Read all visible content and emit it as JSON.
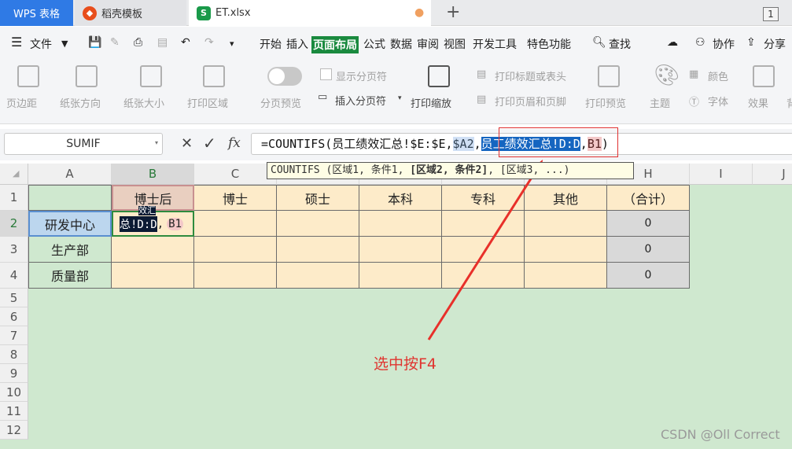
{
  "tabs": {
    "wps": "WPS 表格",
    "daoke": "稻壳模板",
    "et": "ET.xlsx",
    "win_count": "1"
  },
  "menu": {
    "file": "文件",
    "items": [
      "开始",
      "插入",
      "页面布局",
      "公式",
      "数据",
      "审阅",
      "视图",
      "开发工具",
      "特色功能"
    ],
    "search": "查找",
    "collab": "协作",
    "share": "分享"
  },
  "ribbon": {
    "items": [
      "页边距",
      "纸张方向",
      "纸张大小",
      "打印区域",
      "分页预览",
      "显示分页符",
      "插入分页符",
      "打印缩放",
      "打印标题或表头",
      "打印页眉和页脚",
      "打印预览",
      "主题",
      "颜色",
      "字体",
      "效果",
      "背"
    ]
  },
  "formula_bar": {
    "name_box": "SUMIF",
    "fx": "fx",
    "formula_p1": "=COUNTIFS(员工绩效汇总!$E:$E,",
    "formula_p2": "$A2",
    "formula_p3": ",",
    "formula_p4": "员工绩效汇总!D:D",
    "formula_p5": ",",
    "formula_p6": "B1",
    "formula_p7": ")"
  },
  "tooltip": {
    "pre": "COUNTIFS (区域1, 条件1, ",
    "bold": "[区域2, 条件2]",
    "post": ", [区域3, ...)"
  },
  "columns": [
    "A",
    "B",
    "C",
    "D",
    "E",
    "F",
    "G",
    "H",
    "I",
    "J"
  ],
  "rows": [
    "1",
    "2",
    "3",
    "4",
    "5",
    "6",
    "7",
    "8",
    "9",
    "10",
    "11",
    "12"
  ],
  "headers": [
    "博士后",
    "博士",
    "硕士",
    "本科",
    "专科",
    "其他",
    "（合计）"
  ],
  "row_labels": [
    "研发中心",
    "生产部",
    "质量部"
  ],
  "totals": [
    "0",
    "0",
    "0"
  ],
  "b2_edit": {
    "top": "效汇",
    "main": "总!D:D",
    "sep": ",",
    "ref": "B1"
  },
  "annotation": "选中按F4",
  "watermark": "CSDN @Oll Correct"
}
